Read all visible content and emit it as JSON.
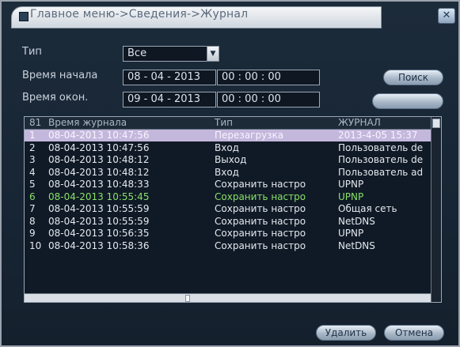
{
  "window": {
    "title": "Главное меню->Сведения->Журнал",
    "close_icon": "close-icon"
  },
  "filters": {
    "type_label": "Тип",
    "type_value": "Все",
    "start_label": "Время начала",
    "start_date": "08 - 04 - 2013",
    "start_time": "00 : 00 : 00",
    "end_label": "Время окон.",
    "end_date": "09 - 04 - 2013",
    "end_time": "00 : 00 : 00",
    "search_button": "Поиск",
    "next_page_button": ""
  },
  "log": {
    "headers": [
      "81",
      "Время журнала",
      "Тип",
      "ЖУРНАЛ"
    ],
    "rows": [
      {
        "n": "1",
        "time": "08-04-2013 10:47:56",
        "type": "Перезагрузка",
        "log": "2013-4-05 15:37",
        "selected": true
      },
      {
        "n": "2",
        "time": "08-04-2013 10:47:56",
        "type": "Вход",
        "log": "Пользователь de"
      },
      {
        "n": "3",
        "time": "08-04-2013 10:48:12",
        "type": "Выход",
        "log": "Пользователь de"
      },
      {
        "n": "4",
        "time": "08-04-2013 10:48:12",
        "type": "Вход",
        "log": "Пользователь ad"
      },
      {
        "n": "5",
        "time": "08-04-2013 10:48:33",
        "type": "Сохранить настро",
        "log": "UPNP"
      },
      {
        "n": "6",
        "time": "08-04-2013 10:55:45",
        "type": "Сохранить настро",
        "log": "UPNP",
        "highlight": true
      },
      {
        "n": "7",
        "time": "08-04-2013 10:55:59",
        "type": "Сохранить настро",
        "log": "Общая сеть"
      },
      {
        "n": "8",
        "time": "08-04-2013 10:55:59",
        "type": "Сохранить настро",
        "log": "NetDNS"
      },
      {
        "n": "9",
        "time": "08-04-2013 10:56:35",
        "type": "Сохранить настро",
        "log": "UPNP"
      },
      {
        "n": "10",
        "time": "08-04-2013 10:58:36",
        "type": "Сохранить настро",
        "log": "NetDNS"
      }
    ]
  },
  "footer": {
    "delete_button": "Удалить",
    "cancel_button": "Отмена"
  },
  "colors": {
    "selected_row": "#c4b7dc",
    "highlight_text": "#89e06a"
  }
}
